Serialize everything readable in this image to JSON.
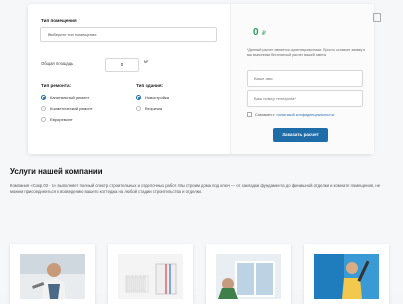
{
  "calculator": {
    "room_type_label": "Тип помещения",
    "room_type_select": "Выберите тип помещения",
    "area_label": "Общая площадь",
    "area_value": "0",
    "area_unit": "м²",
    "repair_type_label": "Тип ремонта:",
    "repair_options": [
      "Капитальный ремонт",
      "Косметический ремонт",
      "Евроремонт"
    ],
    "building_type_label": "Тип здания:",
    "building_options": [
      "Новостройка",
      "Вторичка"
    ]
  },
  "result": {
    "price": "0",
    "currency": "₽",
    "note": "*Данный расчет является ориентировочным. Просто оставьте заявку и мы выполним бесплатный расчет вашей сметы",
    "name_placeholder": "Ваше имя",
    "phone_placeholder": "Ваш номер телефона*",
    "agree_text": "Согласен с",
    "agree_link": "политикой конфиденциальности",
    "submit_label": "Заказать расчет"
  },
  "services": {
    "title": "Услуги нашей компании",
    "text": "Компания «Сокр.03 - 1» выполняет полный спектр строительных и отделочных работ. Мы строим дома под ключ — от закладки фундамента до финишной отделки и комнате помещения, не можем присоединиться к возведению вашего коттеджа на любой стадии строительства и отделки."
  },
  "colors": {
    "accent": "#1e6da8",
    "price": "#2d9b5a"
  }
}
